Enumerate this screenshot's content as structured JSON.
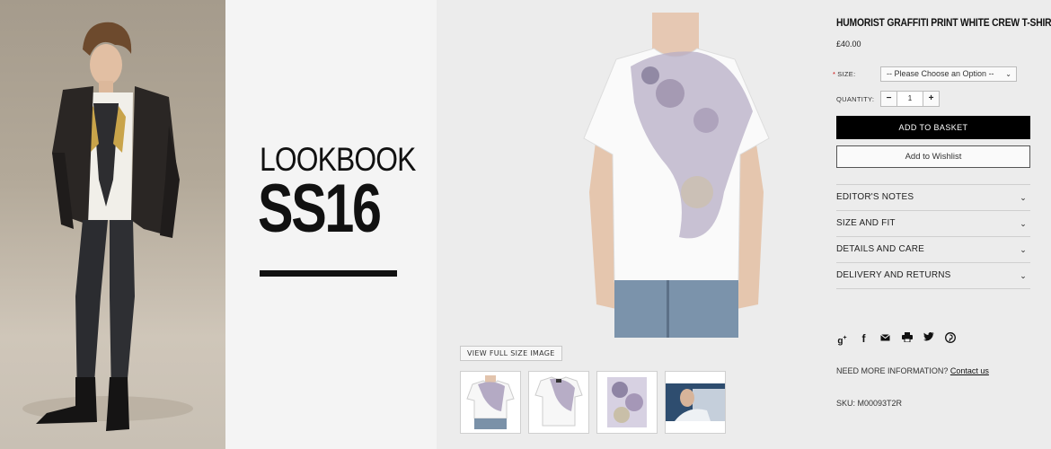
{
  "lookbook": {
    "title": "LOOKBOOK",
    "season": "SS16"
  },
  "product": {
    "title": "HUMORIST GRAFFITI PRINT WHITE CREW T-SHIRT",
    "price": "£40.00",
    "size_label": "SIZE:",
    "size_required_mark": "*",
    "size_placeholder": "-- Please Choose an Option --",
    "quantity_label": "QUANTITY:",
    "quantity_minus": "−",
    "quantity_value": "1",
    "quantity_plus": "+",
    "add_to_basket": "ADD TO BASKET",
    "add_to_wishlist": "Add to Wishlist",
    "view_full_size": "VIEW FULL SIZE IMAGE",
    "accordion": [
      {
        "label": "EDITOR'S NOTES"
      },
      {
        "label": "SIZE AND FIT"
      },
      {
        "label": "DETAILS AND CARE"
      },
      {
        "label": "DELIVERY AND RETURNS"
      }
    ],
    "chevron": "⌄",
    "share_icons": [
      "google-plus-icon",
      "facebook-icon",
      "email-icon",
      "print-icon",
      "twitter-icon",
      "pinterest-icon"
    ],
    "need_info_text": "NEED MORE INFORMATION?",
    "contact_link": "Contact us",
    "sku": "SKU:  M00093T2R"
  },
  "colors": {
    "accent": "#000000",
    "background": "#ececec"
  }
}
